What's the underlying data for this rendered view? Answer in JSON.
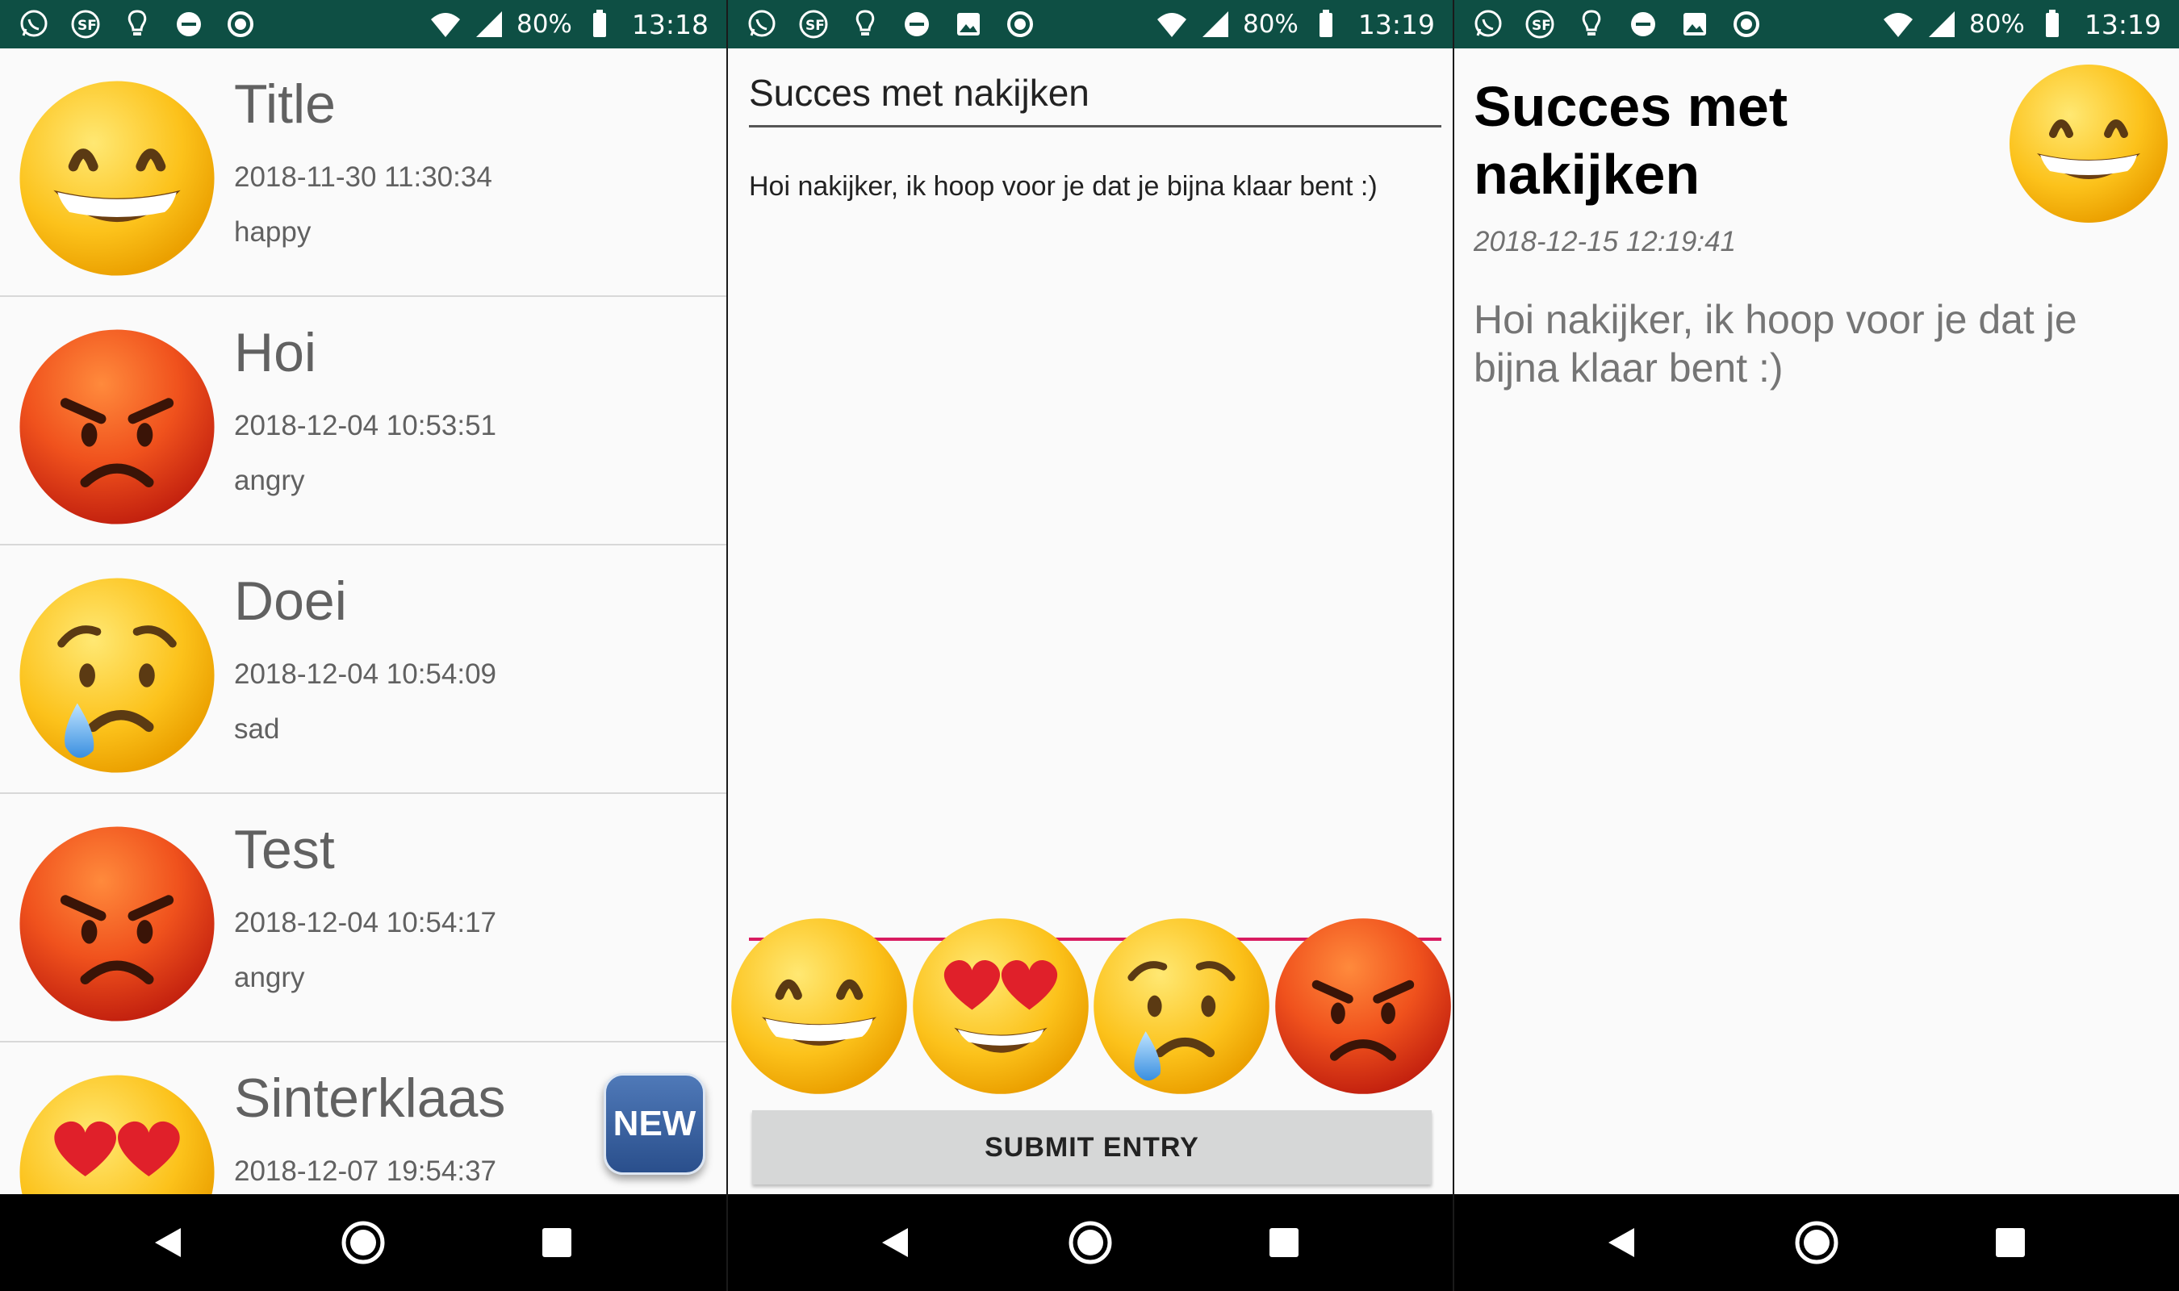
{
  "list_screen": {
    "status": {
      "battery": "80%",
      "time": "13:18"
    },
    "entries": [
      {
        "title": "Title",
        "date": "2018-11-30 11:30:34",
        "mood": "happy"
      },
      {
        "title": "Hoi",
        "date": "2018-12-04 10:53:51",
        "mood": "angry"
      },
      {
        "title": "Doei",
        "date": "2018-12-04 10:54:09",
        "mood": "sad"
      },
      {
        "title": "Test",
        "date": "2018-12-04 10:54:17",
        "mood": "angry"
      },
      {
        "title": "Sinterklaas",
        "date": "2018-12-07 19:54:37",
        "mood": ""
      }
    ],
    "fab_label": "NEW"
  },
  "compose_screen": {
    "status": {
      "battery": "80%",
      "time": "13:19"
    },
    "title_value": "Succes met nakijken",
    "body_value": "Hoi nakijker, ik hoop voor je dat je bijna klaar bent :)",
    "submit_label": "SUBMIT ENTRY"
  },
  "detail_screen": {
    "status": {
      "battery": "80%",
      "time": "13:19"
    },
    "title": "Succes met nakijken",
    "date": "2018-12-15 12:19:41",
    "body": "Hoi nakijker, ik hoop voor je dat je bijna klaar bent :)"
  },
  "icons": {
    "status_left": [
      "whatsapp-icon",
      "sf-app-icon",
      "lightbulb-icon",
      "do-not-disturb-icon",
      "image-icon",
      "circle-app-icon"
    ],
    "status_right": [
      "wifi-icon",
      "signal-icon",
      "battery-icon"
    ],
    "nav": [
      "back-icon",
      "home-icon",
      "recents-icon"
    ],
    "moods": [
      "happy-emoji-icon",
      "heart-eyes-emoji-icon",
      "sad-emoji-icon",
      "angry-emoji-icon"
    ]
  },
  "colors": {
    "status_bar": "#0e4f44",
    "accent": "#d81b60",
    "list_text": "#616161",
    "button_bg": "#d6d7d7",
    "fab": "#3b63a3"
  }
}
